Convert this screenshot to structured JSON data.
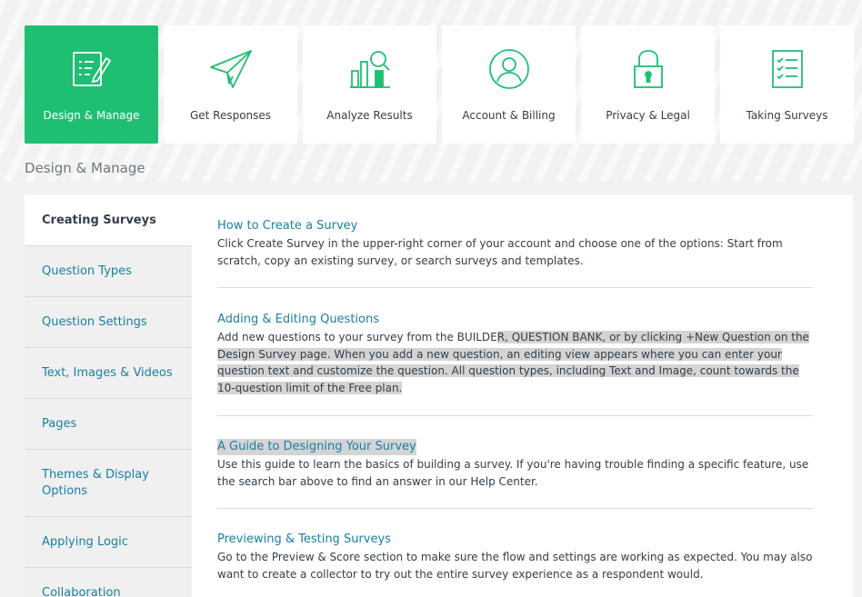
{
  "tiles": [
    {
      "label": "Design & Manage",
      "icon": "edit-document-icon",
      "active": true
    },
    {
      "label": "Get Responses",
      "icon": "paper-plane-icon",
      "active": false
    },
    {
      "label": "Analyze Results",
      "icon": "bar-chart-magnifier-icon",
      "active": false
    },
    {
      "label": "Account & Billing",
      "icon": "user-circle-icon",
      "active": false
    },
    {
      "label": "Privacy & Legal",
      "icon": "padlock-icon",
      "active": false
    },
    {
      "label": "Taking Surveys",
      "icon": "checklist-icon",
      "active": false
    }
  ],
  "section_title": "Design & Manage",
  "sidebar": {
    "items": [
      {
        "label": "Creating Surveys",
        "active": true
      },
      {
        "label": "Question Types"
      },
      {
        "label": "Question Settings"
      },
      {
        "label": "Text, Images & Videos"
      },
      {
        "label": "Pages"
      },
      {
        "label": "Themes & Display Options"
      },
      {
        "label": "Applying Logic"
      },
      {
        "label": "Collaboration"
      }
    ]
  },
  "articles": [
    {
      "title": "How to Create a Survey",
      "text": "Click Create Survey in the upper-right corner of your account and choose one of the options: Start from scratch, copy an existing survey, or search surveys and templates."
    },
    {
      "title": "Adding & Editing Questions",
      "text_before": "Add new questions to your survey from the BUILDE",
      "text_highlight": "R, QUESTION BANK, or by clicking +New Question on the Design Survey page. When you add a new question, an editing view appears where you can enter your question text and customize the question. All question types, including Text and Image, count towards the 10-question limit of the Free plan."
    },
    {
      "title": "A Guide to Designing Your Survey",
      "text": "Use this guide to learn the basics of building a survey. If you're having trouble finding a specific feature, use the search bar above to find an answer in our Help Center."
    },
    {
      "title": "Previewing & Testing Surveys",
      "text": "Go to the Preview & Score section to make sure the flow and settings are working as expected. You may also want to create a collector to try out the entire survey experience as a respondent would."
    }
  ],
  "colors": {
    "accent": "#1fbf73",
    "link": "#1a7fa3",
    "text": "#333e48",
    "highlight": "#d4d4d4"
  }
}
